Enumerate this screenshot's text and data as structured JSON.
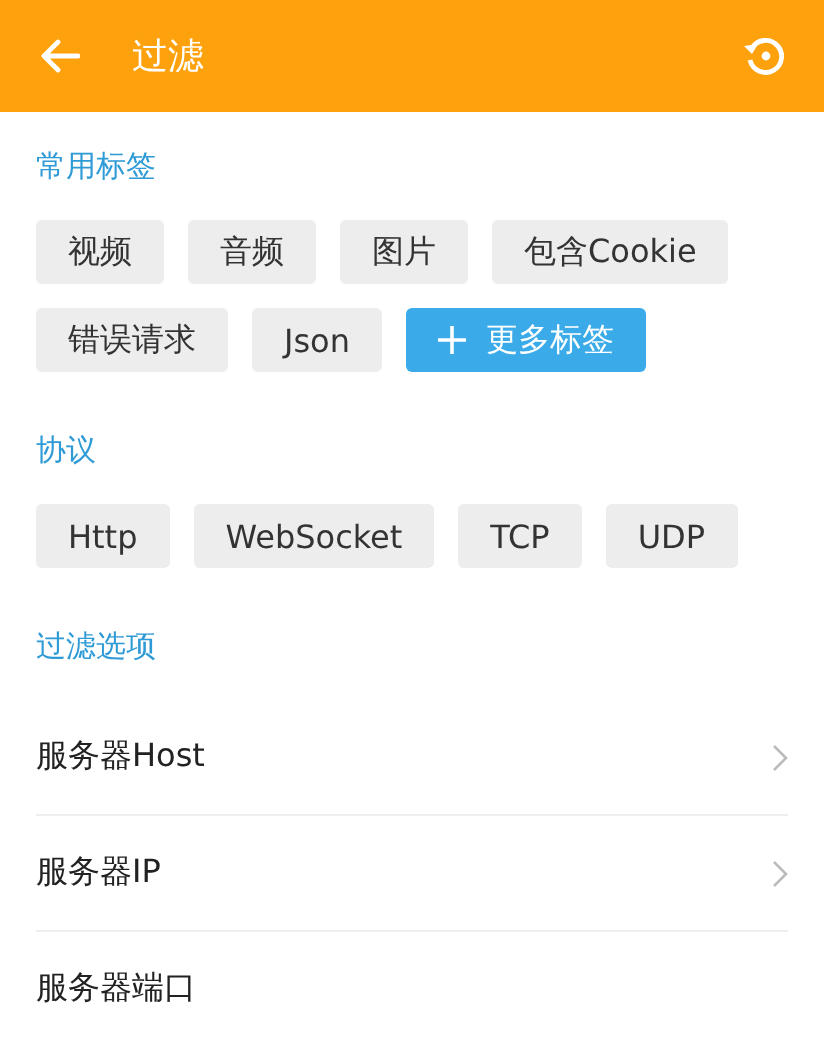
{
  "header": {
    "title": "过滤"
  },
  "sections": [
    {
      "title": "常用标签",
      "kind": "tags",
      "tags": [
        {
          "label": "视频",
          "kind": "tag"
        },
        {
          "label": "音频",
          "kind": "tag"
        },
        {
          "label": "图片",
          "kind": "tag"
        },
        {
          "label": "包含Cookie",
          "kind": "tag"
        },
        {
          "label": "错误请求",
          "kind": "tag"
        },
        {
          "label": "Json",
          "kind": "tag"
        },
        {
          "label": "更多标签",
          "kind": "add"
        }
      ]
    },
    {
      "title": "协议",
      "kind": "tags",
      "tags": [
        {
          "label": "Http",
          "kind": "tag"
        },
        {
          "label": "WebSocket",
          "kind": "tag"
        },
        {
          "label": "TCP",
          "kind": "tag"
        },
        {
          "label": "UDP",
          "kind": "tag"
        }
      ]
    },
    {
      "title": "过滤选项",
      "kind": "options",
      "options": [
        {
          "label": "服务器Host",
          "chevron": true
        },
        {
          "label": "服务器IP",
          "chevron": true
        },
        {
          "label": "服务器端口",
          "chevron": false
        }
      ]
    }
  ]
}
